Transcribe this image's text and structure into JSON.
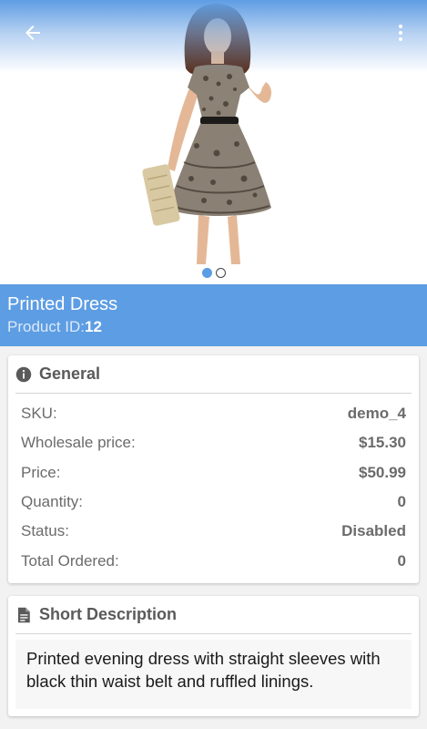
{
  "header": {
    "back_icon": "arrow-left-icon",
    "menu_icon": "more-vertical-icon",
    "gradient_color": "#5e9de3"
  },
  "hero": {
    "image": "product-photo-woman-in-printed-dress",
    "pager": {
      "count": 2,
      "active_index": 0
    }
  },
  "product": {
    "name": "Printed Dress",
    "id_label": "Product ID:",
    "id_value": "12"
  },
  "general": {
    "title": "General",
    "icon": "info-icon",
    "rows": [
      {
        "label": "SKU:",
        "value": "demo_4"
      },
      {
        "label": "Wholesale price:",
        "value": "$15.30"
      },
      {
        "label": "Price:",
        "value": "$50.99"
      },
      {
        "label": "Quantity:",
        "value": "0"
      },
      {
        "label": "Status:",
        "value": "Disabled"
      },
      {
        "label": "Total Ordered:",
        "value": "0"
      }
    ]
  },
  "short_description": {
    "title": "Short Description",
    "icon": "document-icon",
    "text": "Printed evening dress with straight sleeves with black thin waist belt and ruffled linings."
  },
  "colors": {
    "accent": "#5d9de3",
    "card_title": "#5a5a5a",
    "text_muted": "#6b6b6b"
  }
}
